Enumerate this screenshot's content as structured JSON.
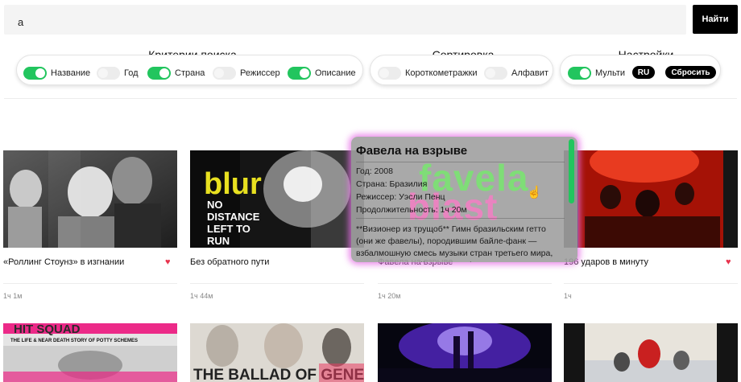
{
  "search": {
    "value": "а",
    "button_label": "Найти"
  },
  "criteria": {
    "title": "Критерии поиска",
    "toggles": [
      {
        "label": "Название",
        "on": true
      },
      {
        "label": "Год",
        "on": false
      },
      {
        "label": "Страна",
        "on": true
      },
      {
        "label": "Режиссер",
        "on": false
      },
      {
        "label": "Описание",
        "on": true
      }
    ]
  },
  "sorting": {
    "title": "Сортировка",
    "toggles": [
      {
        "label": "Короткометражки",
        "on": false
      },
      {
        "label": "Алфавит",
        "on": false
      }
    ]
  },
  "settings": {
    "title": "Настройки",
    "multi": {
      "label": "Мульти",
      "on": true
    },
    "lang_label": "RU",
    "reset_label": "Сбросить"
  },
  "movies": [
    {
      "title": "«Роллинг Стоунз» в изгнании",
      "duration": "1ч 1м",
      "favorite": true
    },
    {
      "title": "Без обратного пути",
      "duration": "1ч 44м",
      "favorite": false
    },
    {
      "title": "Фавела на взрыве",
      "duration": "1ч 20м",
      "favorite": true
    },
    {
      "title": "196 ударов в минуту",
      "duration": "1ч",
      "favorite": true
    }
  ],
  "posters": {
    "blur_logo": "blur",
    "blur_tagline": [
      "NO",
      "DISTANCE",
      "LEFT TO",
      "RUN"
    ],
    "hitsquad_title": "HIT SQUAD",
    "hitsquad_sub": "THE LIFE & NEAR DEATH STORY OF POTTY SCHEMES",
    "ballad_title": "THE BALLAD OF GENESIS"
  },
  "tooltip": {
    "title": "Фавела на взрыве",
    "watermark_top": "favela",
    "watermark_bottom": "blast",
    "year": "Год: 2008",
    "country": "Страна: Бразилия",
    "director": "Режиссер: Уэсли Пенц",
    "duration": "Продолжительность: 1ч 20м",
    "description": "**Визионер из трущоб** Гимн бразильским гетто (они же фавелы), породившим байле-фанк — взбалмошную смесь музыки стран третьего мира, нелегального рейва и злого фанка, на"
  }
}
